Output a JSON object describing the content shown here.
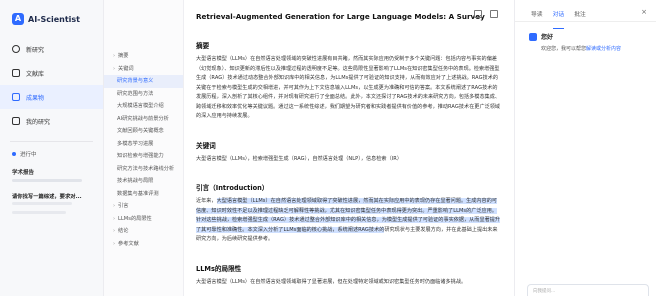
{
  "brand": {
    "name": "AI-Scientist"
  },
  "nav": [
    {
      "label": "新研究",
      "icon": "plus-circle-icon"
    },
    {
      "label": "文献库",
      "icon": "library-icon"
    },
    {
      "label": "成果物",
      "icon": "artifact-icon"
    },
    {
      "label": "我的研究",
      "icon": "folder-icon"
    }
  ],
  "sidebar": {
    "progress_label": "进行中",
    "recent_title": "学术报告",
    "recent_item": "请你找写一篇综述，要求对..."
  },
  "outline": [
    {
      "label": "摘要",
      "caret": "›"
    },
    {
      "label": "关键词",
      "caret": "›"
    },
    {
      "label": "研究背景与意义",
      "caret": ""
    },
    {
      "label": "研究范围与方法",
      "caret": ""
    },
    {
      "label": "大规模语言模型介绍",
      "caret": ""
    },
    {
      "label": "AI研究挑战与前景分析",
      "caret": ""
    },
    {
      "label": "文献回顾与关键概念",
      "caret": ""
    },
    {
      "label": "多模态学习进展",
      "caret": ""
    },
    {
      "label": "知识检索与增强能力",
      "caret": ""
    },
    {
      "label": "研究方法与技术路线分析",
      "caret": ""
    },
    {
      "label": "技术挑战与局限",
      "caret": ""
    },
    {
      "label": "数据集与基准评测",
      "caret": ""
    },
    {
      "label": "引言",
      "caret": "›"
    },
    {
      "label": "LLMs的局限性",
      "caret": "›"
    },
    {
      "label": "结论",
      "caret": "›"
    },
    {
      "label": "参考文献",
      "caret": "›"
    }
  ],
  "doc": {
    "title": "Retrieval-Augmented Generation for Large Language Models: A Survey",
    "abstract_heading": "摘要",
    "abstract": "大型语言模型（LLMs）在自然语言处理领域的突破性进展有目共睹，然而其实际应用仍受制于多个关键问题：包括内容与事实的偏差（幻觉现象）、知识更新的滞后性以及推理过程的透明度不足等。这些局限性显著影响了LLMs在知识密集型任务中的表现。检索增强型生成（RAG）技术通过动态整合外部知识库中的相关信息，为LLMs提供了可验证的知识支持，从而有效应对了上述挑战。RAG技术的关键在于检索与模型生成的交相增进，并可其作为上下文信息输入LLMs，以生成更为准确和可信的答案。本文系统阐述了RAG技术的发展历程，深入剖析了其核心组件，并对现有研究进行了全面总结。此外，本文还探讨了RAG技术的未来研究方向，包括多模态集成、跨领域迁移和效率优化等关键议题。通过这一系统性综述，我们期望为研究者和实践者提供有价值的参考，推动RAG技术在更广泛领域的深入应用与持续发展。",
    "keywords_heading": "关键词",
    "keywords": "大型语言模型（LLMs），检索增强型生成（RAG），自然语言处理（NLP），信息检索（IR）",
    "intro_heading": "引言（Introduction）",
    "intro_pre": "近年来，",
    "intro_hl": "大型语言模型（LLMs）在自然语言处理领域取得了突破性进展，然而其在实际应用中的表现仍存在显著问题。生成内容的可信度、知识时效性不足以及推理过程缺乏可解释性等挑战，尤其在知识密集型任务中表现得更为突出。严重影响了LLMs的广泛应用。针对这些挑战，检索增强型生成（RAG）技术通过整合外部知识库中的相关信息，为模型生成提供了可验证的事实依据，从而显著提升了其可靠性和准确性。本文深入分析了LLMs面临的核心挑战，系统阐述RAG技术的",
    "intro_post": "研究现状与主要发展方向，并在此基础上提出未来研究方向，为后续研究提供参考。",
    "limits_heading": "LLMs的局限性",
    "limits": "大型语言模型（LLMs）在自然语言处理领域取得了显著进展，但在处理特定领域或知识密集型任务时仍面临诸多挑战。"
  },
  "right": {
    "tabs": [
      "导读",
      "对话",
      "批注"
    ],
    "active_tab": 1,
    "greeting": "您好",
    "message_prefix": "欢迎您，我可以帮您",
    "message_link": "解读或分析内容",
    "input_placeholder": "向我提问..."
  },
  "colors": {
    "accent": "#2f6bff",
    "highlight": "#cfe0ff"
  }
}
